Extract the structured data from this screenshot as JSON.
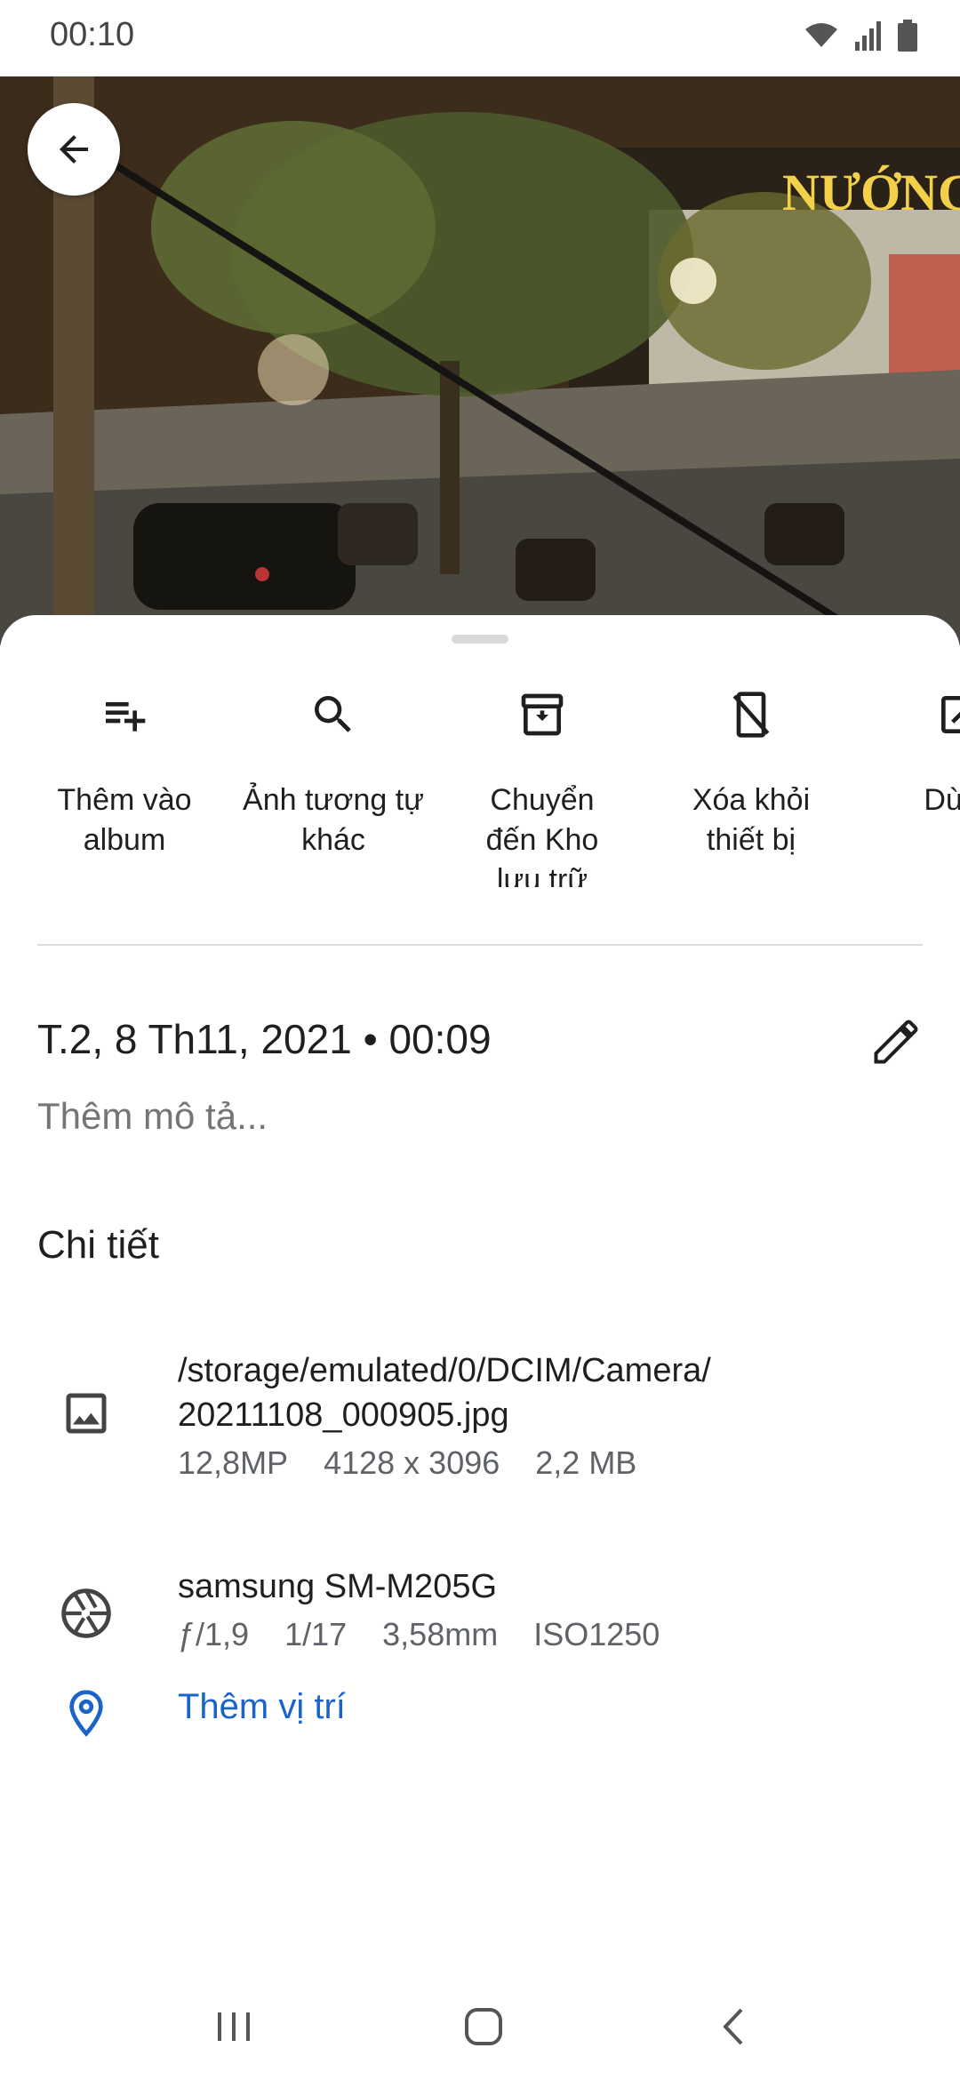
{
  "status_bar": {
    "time": "00:10",
    "icons": [
      "wifi-icon",
      "signal-icon",
      "battery-icon"
    ]
  },
  "photo": {
    "sign_text": "NƯỚNG"
  },
  "actions": [
    {
      "icon": "playlist-add-icon",
      "label": "Thêm vào album"
    },
    {
      "icon": "search-icon",
      "label": "Ảnh tương tự khác"
    },
    {
      "icon": "archive-icon",
      "label": "Chuyển đến Kho lưu trữ"
    },
    {
      "icon": "phone-remove-icon",
      "label": "Xóa khỏi thiết bị"
    },
    {
      "icon": "open-with-icon",
      "label": "Dùng"
    }
  ],
  "date": {
    "text": "T.2, 8 Th11, 2021  •  00:09"
  },
  "description_placeholder": "Thêm mô tả...",
  "details": {
    "heading": "Chi tiết",
    "file": {
      "path_line1": "/storage/emulated/0/DCIM/Camera/",
      "path_line2": "20211108_000905.jpg",
      "megapixels": "12,8MP",
      "resolution": "4128 x 3096",
      "size": "2,2 MB"
    },
    "camera": {
      "model": "samsung SM-M205G",
      "aperture": "ƒ/1,9",
      "shutter": "1/17",
      "focal_length": "3,58mm",
      "iso": "ISO1250"
    },
    "location_link": "Thêm vị trí"
  },
  "colors": {
    "link": "#1a64c9",
    "text": "#1f1f1f",
    "secondary_text": "#5f6368"
  }
}
